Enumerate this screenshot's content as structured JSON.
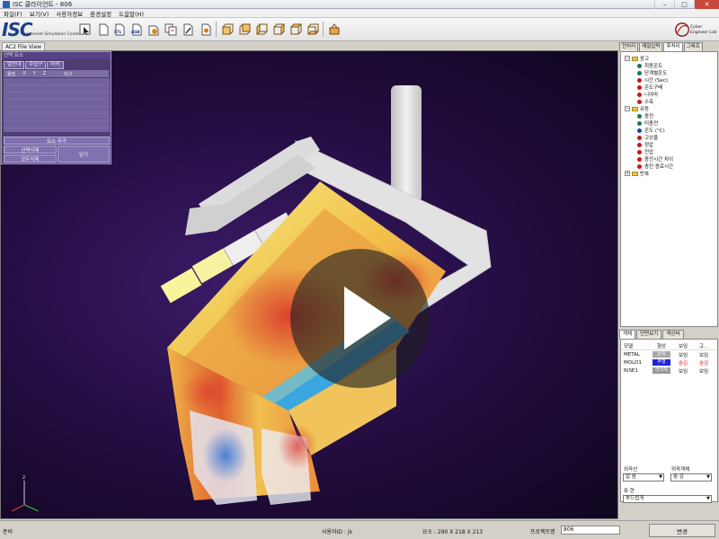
{
  "window": {
    "title": "ISC 클라이언트 - 806"
  },
  "menu": [
    "파일(F)",
    "보기(V)",
    "사용자정보",
    "환경설정",
    "도움말(H)"
  ],
  "logo": {
    "text": "ISC",
    "subtitle": "Internet Simulation Center"
  },
  "toolbar": {
    "stl_label": "STL",
    "agb_label": "AGB",
    "brand1": "Cyber",
    "brand2": "Engineer Lab"
  },
  "view_tab": "AC2 File View",
  "float_panel": {
    "title": "선택 요소",
    "tabs": [
      "열전대",
      "주입구",
      "마커"
    ],
    "columns": [
      "물질",
      "X",
      "Y",
      "Z",
      "비고"
    ],
    "add_button": "요소 추가",
    "select_delete": "선택삭제",
    "delete_all": "모두삭제",
    "close": "닫기"
  },
  "right_tabs": [
    "전처리",
    "재질입력",
    "후처리",
    "그래프"
  ],
  "tree": {
    "groups": [
      {
        "label": "응고",
        "items": [
          {
            "label": "최종온도",
            "color": "#1c7a4a"
          },
          {
            "label": "단계별온도",
            "color": "#1c7a4a"
          },
          {
            "label": "시간 (Sec)",
            "color": "#c81818"
          },
          {
            "label": "온도구배",
            "color": "#c81818"
          },
          {
            "label": "니야마",
            "color": "#c81818"
          },
          {
            "label": "수축",
            "color": "#c81818"
          }
        ]
      },
      {
        "label": "유동",
        "items": [
          {
            "label": "충전",
            "color": "#1c7a4a"
          },
          {
            "label": "미충전",
            "color": "#1c7a4a"
          },
          {
            "label": "온도 (°C)",
            "color": "#1a3fa8"
          },
          {
            "label": "고상율",
            "color": "#c81818"
          },
          {
            "label": "정압",
            "color": "#c81818"
          },
          {
            "label": "전압",
            "color": "#c81818"
          },
          {
            "label": "충전시간 차이",
            "color": "#c81818"
          },
          {
            "label": "충전 종료시간",
            "color": "#c81818"
          }
        ]
      },
      {
        "label": "반복",
        "items": []
      }
    ]
  },
  "lower_tabs": [
    "객체",
    "단면보기",
    "색상바"
  ],
  "materials": {
    "columns": [
      "모델",
      "형상",
      "보임",
      "고..."
    ],
    "rows": [
      {
        "name": "METAL",
        "shape": "금속",
        "shape_color": "#a8a8a8",
        "visible": "보임",
        "vis_color": "#111111",
        "trans": "보임",
        "trans_color": "#111111"
      },
      {
        "name": "MOLD1",
        "shape": "주형",
        "shape_color": "#2222d8",
        "visible": "숨김",
        "vis_color": "#d81818",
        "trans": "숨김",
        "trans_color": "#d81818"
      },
      {
        "name": "RISE1",
        "shape": "라이저",
        "shape_color": "#9a9a9a",
        "visible": "보임",
        "vis_color": "#111111",
        "trans": "보임",
        "trans_color": "#111111"
      }
    ]
  },
  "bottom_controls": {
    "outline_label": "외곽선",
    "outline_value": "없 음",
    "object_label": "외곽객체",
    "object_value": "숨 김",
    "render_label": "표 현",
    "render_value": "부드럽게"
  },
  "status": {
    "ready": "준비",
    "user": "사용자ID : jk",
    "elements": "요소 : 290 X 218 X 213",
    "project_label": "프로젝트명",
    "project_value": "806",
    "change_button": "변경"
  }
}
